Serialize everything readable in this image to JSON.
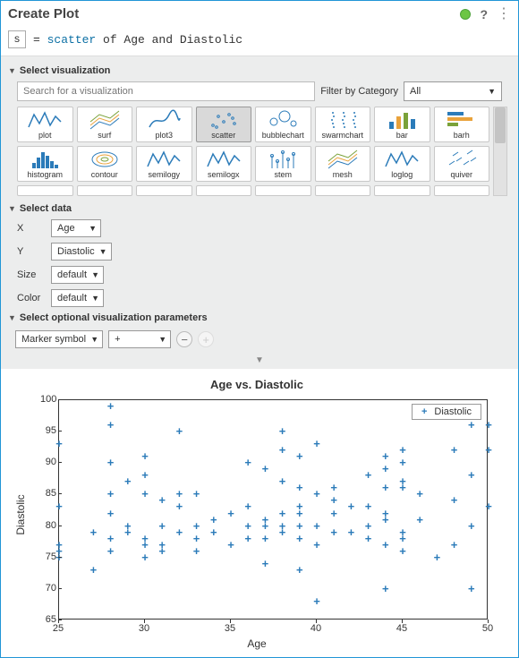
{
  "title": "Create Plot",
  "formula_var": "s",
  "formula_prefix": "= ",
  "formula_kw": "scatter",
  "formula_rest": " of Age and Diastolic",
  "sections": {
    "viz": "Select visualization",
    "data": "Select data",
    "opt": "Select optional visualization parameters"
  },
  "search": {
    "placeholder": "Search for a visualization"
  },
  "filter": {
    "label": "Filter by Category",
    "value": "All"
  },
  "gallery": [
    {
      "label": "plot",
      "type": "line",
      "selected": false
    },
    {
      "label": "surf",
      "type": "surf",
      "selected": false
    },
    {
      "label": "plot3",
      "type": "line3",
      "selected": false
    },
    {
      "label": "scatter",
      "type": "scatter",
      "selected": true
    },
    {
      "label": "bubblechart",
      "type": "bubble",
      "selected": false
    },
    {
      "label": "swarmchart",
      "type": "swarm",
      "selected": false
    },
    {
      "label": "bar",
      "type": "bar",
      "selected": false
    },
    {
      "label": "barh",
      "type": "barh",
      "selected": false
    },
    {
      "label": "histogram",
      "type": "hist",
      "selected": false
    },
    {
      "label": "contour",
      "type": "contour",
      "selected": false
    },
    {
      "label": "semilogy",
      "type": "line",
      "selected": false
    },
    {
      "label": "semilogx",
      "type": "line",
      "selected": false
    },
    {
      "label": "stem",
      "type": "stem",
      "selected": false
    },
    {
      "label": "mesh",
      "type": "surf",
      "selected": false
    },
    {
      "label": "loglog",
      "type": "line",
      "selected": false
    },
    {
      "label": "quiver",
      "type": "quiver",
      "selected": false
    }
  ],
  "data_rows": {
    "x": {
      "label": "X",
      "value": "Age"
    },
    "y": {
      "label": "Y",
      "value": "Diastolic"
    },
    "size": {
      "label": "Size",
      "value": "default"
    },
    "color": {
      "label": "Color",
      "value": "default"
    }
  },
  "opt_param": {
    "selector": "Marker symbol",
    "value": "+"
  },
  "chart_data": {
    "type": "scatter",
    "title": "Age vs. Diastolic",
    "xlabel": "Age",
    "ylabel": "Diastolic",
    "xlim": [
      25,
      50
    ],
    "ylim": [
      65,
      100
    ],
    "xticks": [
      25,
      30,
      35,
      40,
      45,
      50
    ],
    "yticks": [
      65,
      70,
      75,
      80,
      85,
      90,
      95,
      100
    ],
    "legend": "Diastolic",
    "marker": "+",
    "x": [
      25,
      25,
      25,
      25,
      25,
      27,
      27,
      28,
      28,
      28,
      28,
      28,
      28,
      28,
      29,
      29,
      29,
      30,
      30,
      30,
      30,
      30,
      30,
      31,
      31,
      31,
      31,
      32,
      32,
      32,
      32,
      33,
      33,
      33,
      33,
      34,
      34,
      35,
      35,
      36,
      36,
      36,
      36,
      37,
      37,
      37,
      37,
      37,
      38,
      38,
      38,
      38,
      38,
      38,
      39,
      39,
      39,
      39,
      39,
      39,
      39,
      40,
      40,
      40,
      40,
      40,
      41,
      41,
      41,
      41,
      42,
      42,
      43,
      43,
      43,
      43,
      44,
      44,
      44,
      44,
      44,
      44,
      44,
      45,
      45,
      45,
      45,
      45,
      45,
      45,
      46,
      46,
      47,
      48,
      48,
      48,
      49,
      49,
      49,
      49,
      50,
      50,
      50
    ],
    "y": [
      76,
      77,
      93,
      83,
      75,
      73,
      79,
      82,
      96,
      99,
      90,
      76,
      85,
      78,
      87,
      80,
      79,
      78,
      91,
      88,
      85,
      75,
      77,
      80,
      84,
      77,
      76,
      85,
      95,
      83,
      79,
      85,
      76,
      80,
      78,
      81,
      79,
      82,
      77,
      83,
      80,
      90,
      78,
      81,
      78,
      89,
      74,
      80,
      87,
      95,
      82,
      92,
      80,
      79,
      91,
      82,
      86,
      80,
      83,
      73,
      78,
      68,
      80,
      93,
      77,
      85,
      79,
      82,
      84,
      86,
      79,
      83,
      78,
      80,
      88,
      83,
      91,
      89,
      86,
      82,
      81,
      77,
      70,
      76,
      87,
      86,
      90,
      92,
      79,
      78,
      81,
      85,
      75,
      77,
      92,
      84,
      88,
      96,
      80,
      70,
      96,
      92,
      83
    ]
  }
}
